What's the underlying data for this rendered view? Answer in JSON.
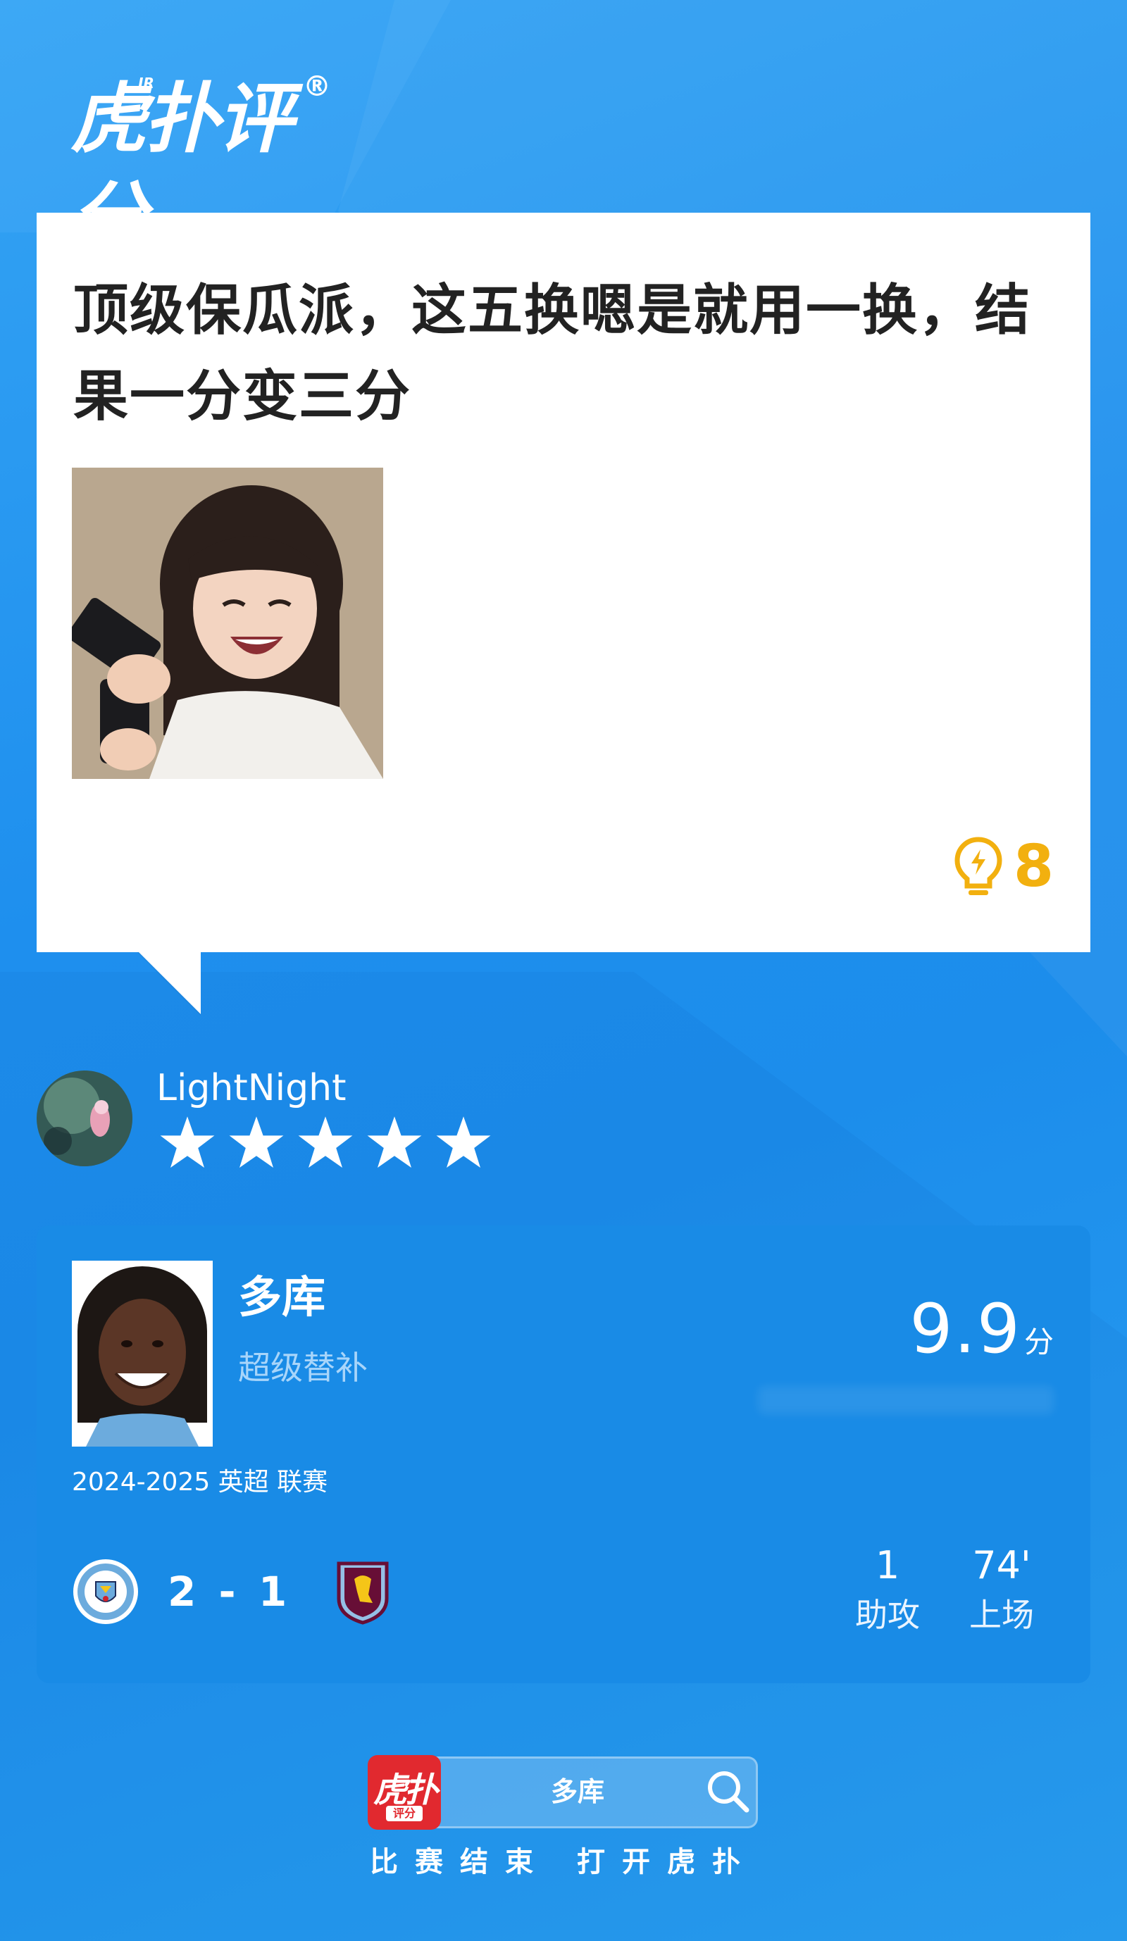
{
  "brand": {
    "logo_text": "虎扑评分",
    "logo_badge": "JR",
    "registered_mark": "®"
  },
  "comment": {
    "text": "顶级保瓜派，这五换嗯是就用一换，结果一分变三分",
    "like_icon": "lightbulb-bolt-icon",
    "like_count": "8"
  },
  "user": {
    "name": "LightNight",
    "rating_stars": 5,
    "rating_max": 5
  },
  "player": {
    "name": "多库",
    "tag": "超级替补",
    "score": "9.9",
    "score_unit": "分",
    "season": "2024-2025 英超 联赛",
    "match": {
      "home_team_icon": "manchester-city-crest-icon",
      "away_team_icon": "aston-villa-crest-icon",
      "score": "2 - 1"
    },
    "stats": [
      {
        "value": "1",
        "label": "助攻"
      },
      {
        "value": "74'",
        "label": "上场"
      }
    ]
  },
  "footer": {
    "app_icon_text": "虎扑",
    "app_icon_sub": "评分",
    "search_text": "多库",
    "caption": "比赛结束 打开虎扑"
  },
  "colors": {
    "background": "#1e8fee",
    "card": "#ffffff",
    "player_card": "#198be6",
    "like": "#f2b00f",
    "app_icon": "#e1292f"
  }
}
